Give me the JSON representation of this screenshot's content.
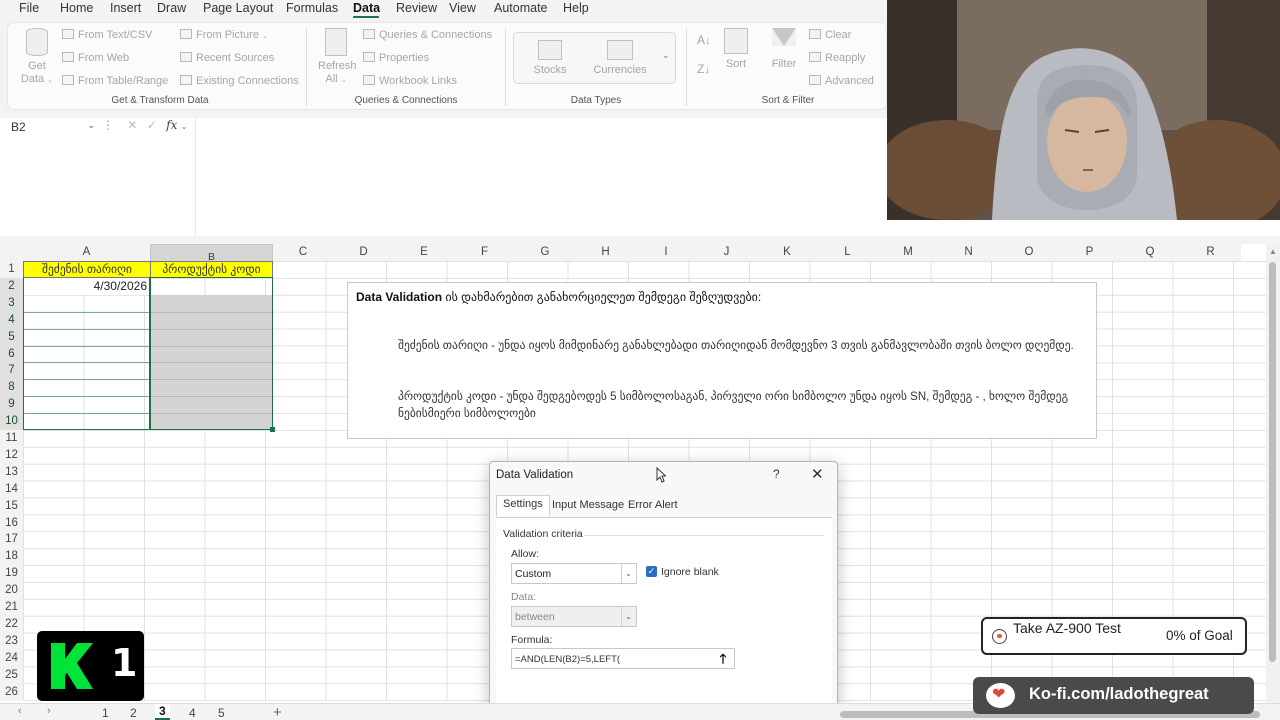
{
  "menu": {
    "items": [
      "File",
      "Home",
      "Insert",
      "Draw",
      "Page Layout",
      "Formulas",
      "Data",
      "Review",
      "View",
      "Automate",
      "Help"
    ],
    "active": "Data"
  },
  "ribbon": {
    "get_data": {
      "label1": "Get",
      "label2": "Data"
    },
    "from_text_csv": "From Text/CSV",
    "from_web": "From Web",
    "from_table_range": "From Table/Range",
    "from_picture": "From Picture",
    "recent_sources": "Recent Sources",
    "existing_connections": "Existing Connections",
    "group_get_transform": "Get & Transform Data",
    "refresh_all": {
      "label1": "Refresh",
      "label2": "All"
    },
    "queries_connections": "Queries & Connections",
    "properties": "Properties",
    "workbook_links": "Workbook Links",
    "group_queries": "Queries & Connections",
    "stocks": "Stocks",
    "currencies": "Currencies",
    "group_data_types": "Data Types",
    "sort": "Sort",
    "filter": "Filter",
    "clear": "Clear",
    "reapply": "Reapply",
    "advanced": "Advanced",
    "group_sort_filter": "Sort & Filter"
  },
  "formula_bar": {
    "name_box": "B2",
    "fx": "fx",
    "content": ""
  },
  "grid": {
    "columns": [
      "A",
      "B",
      "C",
      "D",
      "E",
      "F",
      "G",
      "H",
      "I",
      "J",
      "K",
      "L",
      "M",
      "N",
      "O",
      "P",
      "Q",
      "R"
    ],
    "rows": [
      "1",
      "2",
      "3",
      "4",
      "5",
      "6",
      "7",
      "8",
      "9",
      "10",
      "11",
      "12",
      "13",
      "14",
      "15",
      "16",
      "17",
      "18",
      "19",
      "20",
      "21",
      "22",
      "23",
      "24",
      "25",
      "26"
    ],
    "a1": "შეძენის თარიღი",
    "b1": "პროდუქტის კოდი",
    "a2": "4/30/2026"
  },
  "textbox": {
    "title_bold": "Data Validation",
    "title_rest": " ის დახმარებით განახორციელეთ შემდეგი შეზღუდვები:",
    "para1": "შეძენის თარიღი - უნდა იყოს მიმდინარე განახლებადი თარიღიდან მომდევნო 3 თვის განმავლობაში თვის ბოლო დღემდე.",
    "para2": "პროდუქტის კოდი - უნდა შედგებოდეს 5 სიმბოლოსაგან, პირველი ორი სიმბოლო უნდა იყოს SN, შემდეგ - , ხოლო შემდეგ ნებისმიერი სიმბოლოები"
  },
  "dialog": {
    "title": "Data Validation",
    "help": "?",
    "close": "✕",
    "tabs": [
      "Settings",
      "Input Message",
      "Error Alert"
    ],
    "section": "Validation criteria",
    "allow_label": "Allow:",
    "allow_value": "Custom",
    "ignore_blank": "Ignore blank",
    "data_label": "Data:",
    "data_value": "between",
    "formula_label": "Formula:",
    "formula_value": "=AND(LEN(B2)=5,LEFT("
  },
  "sheets": {
    "tabs": [
      "1",
      "2",
      "3",
      "4",
      "5"
    ],
    "active": "3",
    "add": "+"
  },
  "overlays": {
    "logo_number": "1",
    "goal_text": "Take AZ-900 Test",
    "goal_progress": "0% of Goal",
    "kofi_url": "Ko-fi.com/ladothegreat"
  },
  "colors": {
    "excel_green": "#1e7145",
    "header_yellow": "#ffff00",
    "logo_green": "#00e33a",
    "kofi_red": "#e2453a"
  }
}
